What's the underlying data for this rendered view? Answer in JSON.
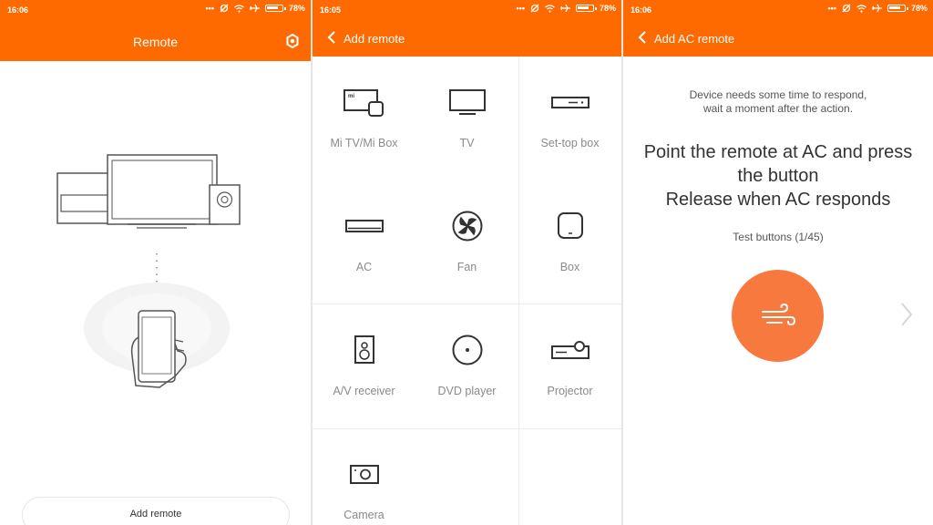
{
  "colors": {
    "accent": "#ff6a00",
    "action_button": "#f8793e"
  },
  "screen1": {
    "status": {
      "time": "16:06",
      "battery": "78%"
    },
    "header": {
      "title": "Remote"
    },
    "add_button_label": "Add remote"
  },
  "screen2": {
    "status": {
      "time": "16:05",
      "battery": "78%"
    },
    "header": {
      "title": "Add remote"
    },
    "devices": [
      {
        "label": "Mi TV/Mi Box",
        "icon": "mi-tv-box-icon"
      },
      {
        "label": "TV",
        "icon": "tv-icon"
      },
      {
        "label": "Set-top box",
        "icon": "set-top-box-icon"
      },
      {
        "label": "AC",
        "icon": "ac-icon"
      },
      {
        "label": "Fan",
        "icon": "fan-icon"
      },
      {
        "label": "Box",
        "icon": "box-icon"
      },
      {
        "label": "A/V receiver",
        "icon": "av-receiver-icon"
      },
      {
        "label": "DVD player",
        "icon": "dvd-player-icon"
      },
      {
        "label": "Projector",
        "icon": "projector-icon"
      },
      {
        "label": "Camera",
        "icon": "camera-icon"
      }
    ]
  },
  "screen3": {
    "status": {
      "time": "16:06",
      "battery": "78%"
    },
    "header": {
      "title": "Add AC remote"
    },
    "hint_line1": "Device needs some time to respond,",
    "hint_line2": "wait a moment after the action.",
    "instruction_line1": "Point the remote at AC and press",
    "instruction_line2": "the button",
    "instruction_line3": "Release when AC responds",
    "test_buttons": "Test buttons (1/45)",
    "action_icon": "wind-icon"
  }
}
